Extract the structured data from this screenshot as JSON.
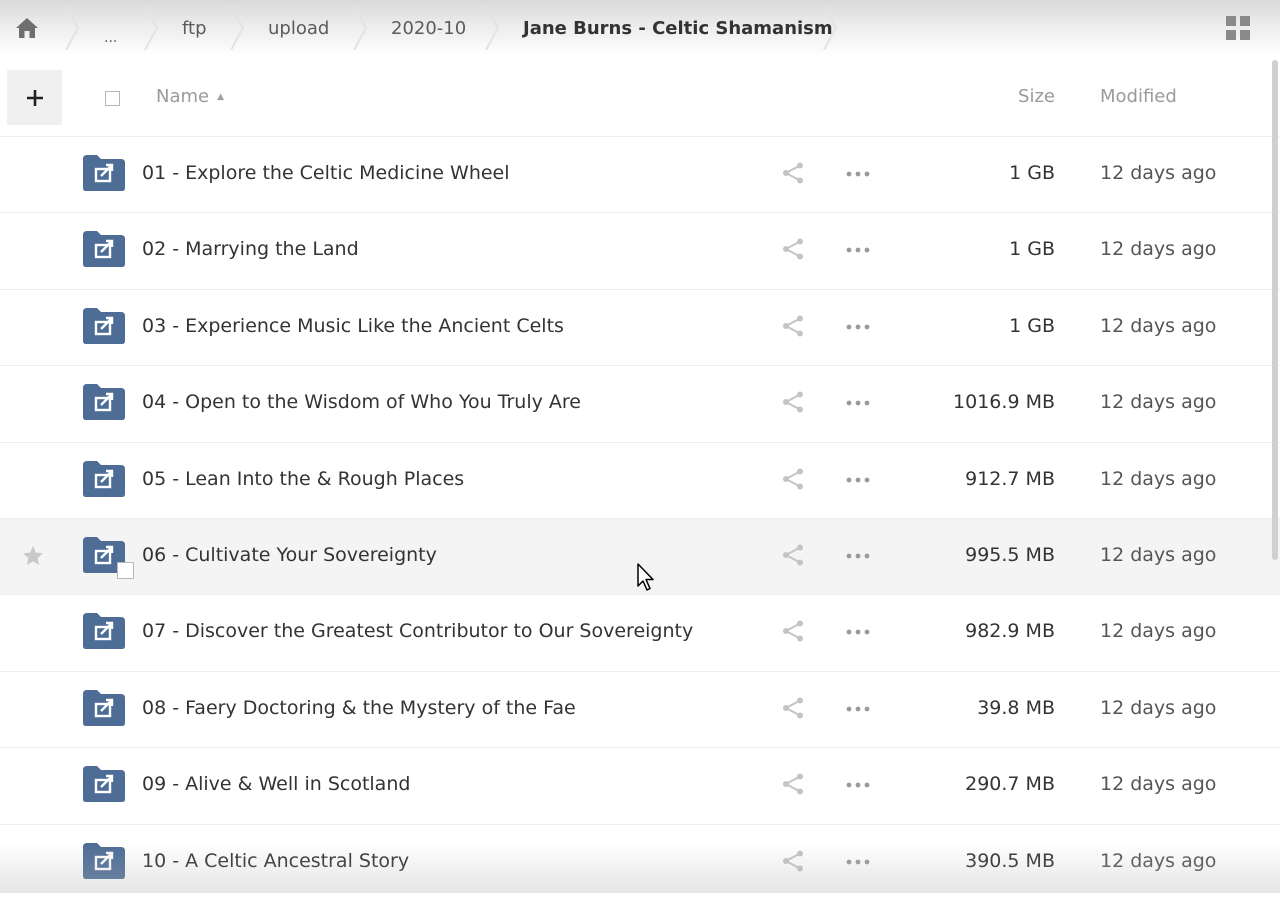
{
  "breadcrumb": {
    "items": [
      {
        "label": "...",
        "type": "ellipsis"
      },
      {
        "label": "ftp"
      },
      {
        "label": "upload"
      },
      {
        "label": "2020-10"
      },
      {
        "label": "Jane Burns - Celtic Shamanism",
        "current": true
      }
    ]
  },
  "header": {
    "add_label": "+",
    "name_label": "Name",
    "size_label": "Size",
    "modified_label": "Modified",
    "sort_indicator": "▲"
  },
  "files": [
    {
      "name": "01 - Explore the Celtic Medicine Wheel",
      "size": "1 GB",
      "modified": "12 days ago"
    },
    {
      "name": "02 - Marrying the Land",
      "size": "1 GB",
      "modified": "12 days ago"
    },
    {
      "name": "03 - Experience Music Like the Ancient Celts",
      "size": "1 GB",
      "modified": "12 days ago"
    },
    {
      "name": "04 - Open to the Wisdom of Who You Truly Are",
      "size": "1016.9 MB",
      "modified": "12 days ago"
    },
    {
      "name": "05 - Lean Into the & Rough Places",
      "size": "912.7 MB",
      "modified": "12 days ago"
    },
    {
      "name": "06 - Cultivate Your Sovereignty",
      "size": "995.5 MB",
      "modified": "12 days ago",
      "hovered": true
    },
    {
      "name": "07 - Discover the Greatest Contributor to Our Sovereignty",
      "size": "982.9 MB",
      "modified": "12 days ago"
    },
    {
      "name": "08 - Faery Doctoring & the Mystery of the Fae",
      "size": "39.8 MB",
      "modified": "12 days ago"
    },
    {
      "name": "09 - Alive & Well in Scotland",
      "size": "290.7 MB",
      "modified": "12 days ago"
    },
    {
      "name": "10 - A Celtic Ancestral Story",
      "size": "390.5 MB",
      "modified": "12 days ago"
    }
  ],
  "colors": {
    "folder": "#4d6d97",
    "icon_gray": "#8a8a8a",
    "hover_row": "#f4f4f4"
  },
  "icons": {
    "home": "home-icon",
    "grid_view": "grid-view-icon",
    "folder": "shared-folder-icon",
    "share": "share-icon",
    "more": "more-icon",
    "star": "star-icon"
  }
}
